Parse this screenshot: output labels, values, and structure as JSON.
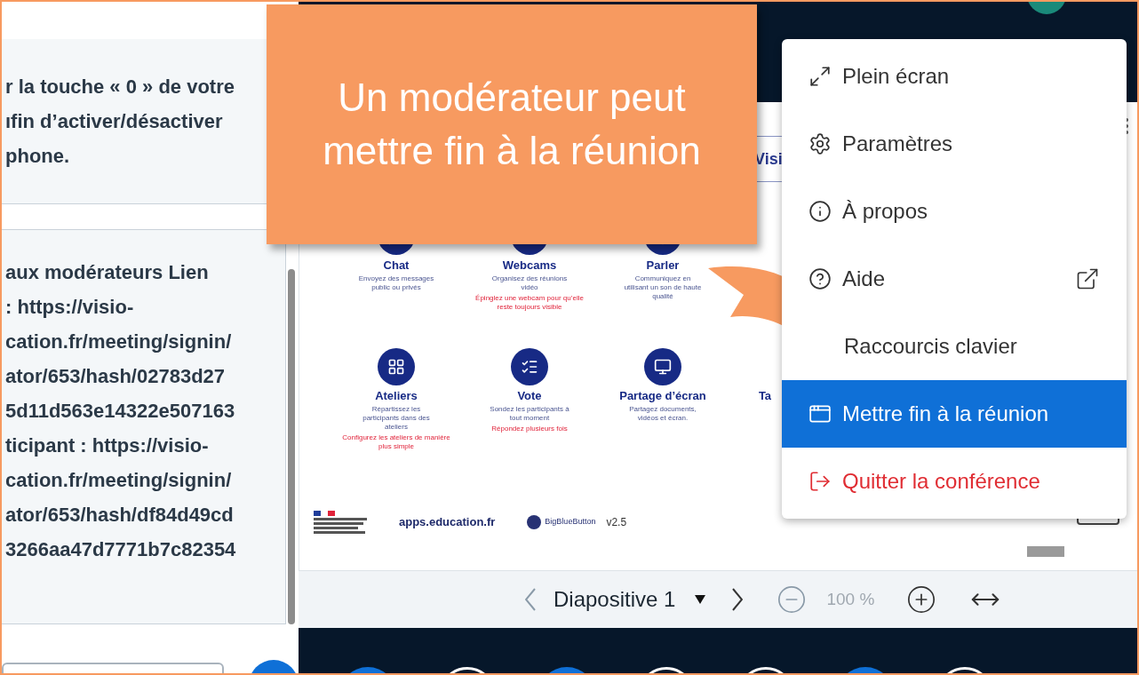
{
  "left_panel": {
    "notice_lines": [
      "r la touche « 0 » de votre",
      "ıfin d’activer/désactiver",
      "phone."
    ],
    "message_lines": [
      "aux modérateurs Lien",
      ": https://visio-",
      "cation.fr/meeting/signin/",
      "ator/653/hash/02783d27",
      "5d11d563e14322e507163",
      "ticipant : https://visio-",
      "cation.fr/meeting/signin/",
      "ator/653/hash/df84d49cd",
      "3266aa47d7771b7c82354"
    ]
  },
  "slide": {
    "tab_label": "Visi",
    "features": [
      {
        "title": "Chat",
        "description": "Envoyez des messages public ou privés"
      },
      {
        "title": "Webcams",
        "description": "Organisez des réunions vidéo",
        "tip": "Épinglez une webcam pour qu’elle reste toujours visible"
      },
      {
        "title": "Parler",
        "description": "Communiquez en utilisant un son de haute qualité"
      },
      {
        "title": "Ateliers",
        "description": "Répartissez les participants dans des ateliers",
        "tip": "Configurez les ateliers de manière plus simple"
      },
      {
        "title": "Vote",
        "description": "Sondez les participants à tout moment",
        "tip": "Répondez plusieurs fois"
      },
      {
        "title": "Partage d’écran",
        "description": "Partagez documents, vidéos et écran."
      },
      {
        "title": "Ta"
      }
    ],
    "footer": {
      "apps_logo": "apps.education.fr",
      "bbb_logo": "BigBlueButton",
      "version": "v2.5"
    }
  },
  "slide_toolbar": {
    "slide_name": "Diapositive 1",
    "zoom": "100 %"
  },
  "action_buttons": [
    {
      "kind": "filled"
    },
    {
      "kind": "outline"
    },
    {
      "kind": "filled"
    },
    {
      "kind": "outline"
    },
    {
      "kind": "outline"
    },
    {
      "kind": "filled"
    },
    {
      "kind": "outline"
    }
  ],
  "menu": {
    "items": [
      {
        "label": "Plein écran",
        "kind": "fullscreen",
        "selected": false
      },
      {
        "label": "Paramètres",
        "kind": "settings",
        "selected": false
      },
      {
        "label": "À propos",
        "kind": "about",
        "selected": false
      },
      {
        "label": "Aide",
        "kind": "help",
        "selected": false
      },
      {
        "label": "Raccourcis clavier",
        "kind": "keyboard",
        "selected": false
      },
      {
        "label": "Mettre fin à la réunion",
        "kind": "end",
        "selected": true
      },
      {
        "label": "Quitter la conférence",
        "kind": "leave",
        "selected": false
      }
    ]
  },
  "callout": {
    "text": "Un modérateur peut mettre fin à la réunion"
  }
}
